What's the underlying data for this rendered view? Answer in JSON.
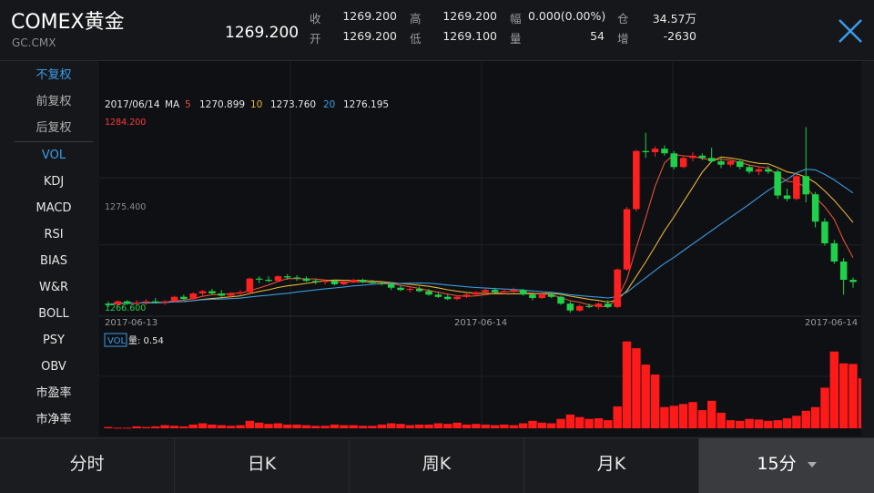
{
  "header": {
    "title": "COMEX黄金",
    "code": "GC.CMX",
    "price": "1269.200",
    "quote": [
      {
        "label": "收",
        "value": "1269.200"
      },
      {
        "label": "开",
        "value": "1269.200"
      },
      {
        "label": "高",
        "value": "1269.200"
      },
      {
        "label": "低",
        "value": "1269.100"
      },
      {
        "label": "幅",
        "value": "0.000(0.00%)"
      },
      {
        "label": "量",
        "value": "54"
      },
      {
        "label": "仓",
        "value": "34.57万"
      },
      {
        "label": "增",
        "value": "-2630"
      }
    ],
    "close_icon": "close-x-icon"
  },
  "sidebar": {
    "adjust": [
      {
        "label": "不复权",
        "active": true
      },
      {
        "label": "前复权",
        "active": false
      },
      {
        "label": "后复权",
        "active": false
      }
    ],
    "indicators": [
      {
        "label": "VOL",
        "active": true
      },
      {
        "label": "KDJ",
        "active": false
      },
      {
        "label": "MACD",
        "active": false
      },
      {
        "label": "RSI",
        "active": false
      },
      {
        "label": "BIAS",
        "active": false
      },
      {
        "label": "W&R",
        "active": false
      },
      {
        "label": "BOLL",
        "active": false
      },
      {
        "label": "PSY",
        "active": false
      },
      {
        "label": "OBV",
        "active": false
      },
      {
        "label": "市盈率",
        "active": false
      },
      {
        "label": "市净率",
        "active": false
      }
    ]
  },
  "chart_data": {
    "type": "candlestick",
    "ma_legend": {
      "date": "2017/06/14",
      "ma_label": "MA",
      "items": [
        {
          "period": "5",
          "value": "1270.899",
          "color": "#e0523a"
        },
        {
          "period": "10",
          "value": "1273.760",
          "color": "#e8b23a"
        },
        {
          "period": "20",
          "value": "1276.195",
          "color": "#3a9be0"
        }
      ]
    },
    "price_labels": {
      "high": "1284.200",
      "mid": "1275.400",
      "low": "1266.600"
    },
    "ylim": [
      1266.6,
      1284.2
    ],
    "x_dates": [
      "2017-06-13",
      "2017-06-14",
      "2017-06-14"
    ],
    "candles_ohlc": [
      [
        1267.3,
        1267.5,
        1267.0,
        1267.2
      ],
      [
        1267.2,
        1267.6,
        1267.1,
        1267.5
      ],
      [
        1267.5,
        1267.6,
        1267.2,
        1267.3
      ],
      [
        1267.3,
        1267.6,
        1267.2,
        1267.4
      ],
      [
        1267.4,
        1267.7,
        1267.2,
        1267.5
      ],
      [
        1267.5,
        1267.8,
        1267.3,
        1267.4
      ],
      [
        1267.4,
        1267.6,
        1267.2,
        1267.5
      ],
      [
        1267.5,
        1268.0,
        1267.4,
        1267.9
      ],
      [
        1267.9,
        1268.1,
        1267.6,
        1267.7
      ],
      [
        1267.7,
        1268.3,
        1267.6,
        1268.2
      ],
      [
        1268.2,
        1268.5,
        1268.0,
        1268.4
      ],
      [
        1268.4,
        1268.6,
        1268.1,
        1268.2
      ],
      [
        1268.2,
        1268.5,
        1267.9,
        1268.0
      ],
      [
        1268.0,
        1268.3,
        1267.8,
        1268.2
      ],
      [
        1268.2,
        1268.5,
        1268.0,
        1268.3
      ],
      [
        1268.3,
        1269.6,
        1268.1,
        1269.5
      ],
      [
        1269.5,
        1269.7,
        1269.1,
        1269.4
      ],
      [
        1269.4,
        1269.7,
        1269.2,
        1269.3
      ],
      [
        1269.3,
        1269.8,
        1269.2,
        1269.7
      ],
      [
        1269.7,
        1269.9,
        1269.4,
        1269.6
      ],
      [
        1269.6,
        1269.8,
        1269.3,
        1269.5
      ],
      [
        1269.5,
        1269.7,
        1269.2,
        1269.3
      ],
      [
        1269.3,
        1269.5,
        1269.0,
        1269.2
      ],
      [
        1269.2,
        1269.4,
        1269.0,
        1269.3
      ],
      [
        1269.3,
        1269.4,
        1268.9,
        1269.0
      ],
      [
        1269.0,
        1269.3,
        1268.9,
        1269.2
      ],
      [
        1269.2,
        1269.5,
        1269.1,
        1269.4
      ],
      [
        1269.4,
        1269.5,
        1269.1,
        1269.2
      ],
      [
        1269.2,
        1269.4,
        1269.0,
        1269.1
      ],
      [
        1269.1,
        1269.3,
        1268.9,
        1269.0
      ],
      [
        1269.0,
        1269.2,
        1268.5,
        1268.7
      ],
      [
        1268.7,
        1268.9,
        1268.4,
        1268.5
      ],
      [
        1268.5,
        1268.8,
        1268.3,
        1268.6
      ],
      [
        1268.6,
        1268.8,
        1268.3,
        1268.4
      ],
      [
        1268.4,
        1268.6,
        1268.0,
        1268.1
      ],
      [
        1268.1,
        1268.3,
        1267.8,
        1267.9
      ],
      [
        1267.9,
        1268.1,
        1267.6,
        1267.7
      ],
      [
        1267.7,
        1268.0,
        1267.6,
        1267.9
      ],
      [
        1267.9,
        1268.2,
        1267.8,
        1268.1
      ],
      [
        1268.1,
        1268.4,
        1268.0,
        1268.3
      ],
      [
        1268.3,
        1268.6,
        1268.1,
        1268.5
      ],
      [
        1268.5,
        1268.7,
        1268.2,
        1268.3
      ],
      [
        1268.3,
        1268.6,
        1268.1,
        1268.4
      ],
      [
        1268.4,
        1268.7,
        1268.2,
        1268.5
      ],
      [
        1268.5,
        1268.6,
        1268.0,
        1268.1
      ],
      [
        1268.1,
        1268.3,
        1267.6,
        1267.8
      ],
      [
        1267.8,
        1268.2,
        1267.7,
        1268.1
      ],
      [
        1268.1,
        1268.3,
        1267.8,
        1267.9
      ],
      [
        1267.9,
        1268.0,
        1267.2,
        1267.3
      ],
      [
        1267.3,
        1267.5,
        1266.5,
        1266.7
      ],
      [
        1266.7,
        1267.2,
        1266.6,
        1267.1
      ],
      [
        1267.1,
        1267.3,
        1266.9,
        1267.0
      ],
      [
        1267.0,
        1267.4,
        1266.8,
        1267.3
      ],
      [
        1267.3,
        1267.6,
        1266.9,
        1267.0
      ],
      [
        1267.0,
        1270.4,
        1266.9,
        1270.3
      ],
      [
        1270.3,
        1275.8,
        1270.2,
        1275.6
      ],
      [
        1275.6,
        1280.8,
        1275.4,
        1280.7
      ],
      [
        1280.7,
        1282.3,
        1280.1,
        1280.6
      ],
      [
        1280.6,
        1281.1,
        1280.2,
        1280.9
      ],
      [
        1280.9,
        1281.2,
        1280.3,
        1280.5
      ],
      [
        1280.5,
        1280.7,
        1279.1,
        1279.3
      ],
      [
        1279.3,
        1280.3,
        1279.2,
        1280.1
      ],
      [
        1280.1,
        1280.6,
        1279.8,
        1280.3
      ],
      [
        1280.3,
        1280.5,
        1279.9,
        1280.1
      ],
      [
        1280.1,
        1281.0,
        1279.7,
        1279.8
      ],
      [
        1279.8,
        1280.1,
        1279.2,
        1279.5
      ],
      [
        1279.5,
        1279.9,
        1279.3,
        1279.8
      ],
      [
        1279.8,
        1280.0,
        1279.1,
        1279.3
      ],
      [
        1279.3,
        1279.5,
        1278.7,
        1278.9
      ],
      [
        1278.9,
        1279.3,
        1278.6,
        1279.1
      ],
      [
        1279.1,
        1279.4,
        1278.7,
        1278.9
      ],
      [
        1278.9,
        1279.1,
        1276.5,
        1276.8
      ],
      [
        1276.8,
        1277.4,
        1276.3,
        1276.5
      ],
      [
        1276.5,
        1278.7,
        1276.4,
        1278.5
      ],
      [
        1278.5,
        1282.8,
        1276.2,
        1276.9
      ],
      [
        1276.9,
        1277.1,
        1274.0,
        1274.5
      ],
      [
        1274.5,
        1274.8,
        1272.4,
        1272.6
      ],
      [
        1272.6,
        1272.9,
        1270.8,
        1271.0
      ],
      [
        1271.0,
        1271.3,
        1268.1,
        1269.4
      ],
      [
        1269.4,
        1269.6,
        1268.7,
        1269.2
      ]
    ],
    "volume": {
      "label": "VOL",
      "text": "量: 0.54",
      "values": [
        0.2,
        0.1,
        0.1,
        0.3,
        0.2,
        0.3,
        0.5,
        0.4,
        0.3,
        0.6,
        0.8,
        0.6,
        0.5,
        0.4,
        0.5,
        1.2,
        0.9,
        0.7,
        0.8,
        0.6,
        0.6,
        0.5,
        0.4,
        0.4,
        0.6,
        0.5,
        0.5,
        0.4,
        0.4,
        0.6,
        0.8,
        0.7,
        0.5,
        0.6,
        0.6,
        0.8,
        0.7,
        0.9,
        0.6,
        0.7,
        0.6,
        0.5,
        0.6,
        0.5,
        0.8,
        1.2,
        0.9,
        0.8,
        1.5,
        2.2,
        1.8,
        1.5,
        1.6,
        1.3,
        3.5,
        13.9,
        12.8,
        10.2,
        8.6,
        3.4,
        3.6,
        3.9,
        4.2,
        2.9,
        4.4,
        2.5,
        1.3,
        1.2,
        1.5,
        1.4,
        1.2,
        1.3,
        1.6,
        2.0,
        2.8,
        3.4,
        6.5,
        12.3,
        10.4,
        10.3,
        8.0,
        5.9
      ]
    }
  },
  "tabs": [
    {
      "label": "分时"
    },
    {
      "label": "日K"
    },
    {
      "label": "周K"
    },
    {
      "label": "月K"
    },
    {
      "label": "15分",
      "selected": true
    }
  ],
  "colors": {
    "up": "#ff2020",
    "down": "#1fd14a",
    "accent": "#3d9be9"
  }
}
